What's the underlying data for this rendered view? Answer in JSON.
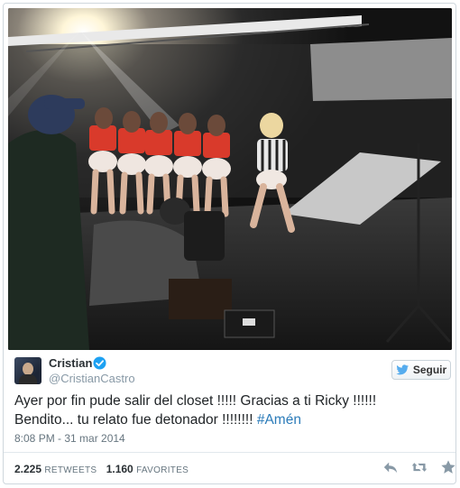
{
  "tweet": {
    "display_name": "Cristian",
    "handle": "@CristianCastro",
    "verified_icon": "verified-badge-icon",
    "follow_label": "Seguir",
    "text_part1": "Ayer por fin pude salir del closet !!!!! Gracias a ti Ricky !!!!!!",
    "text_part2": "Bendito... tu relato fue detonador !!!!!!!! ",
    "hashtag": "#Amén",
    "timestamp": "8:08 PM - 31 mar 2014",
    "retweets_count": "2.225",
    "retweets_label": "RETWEETS",
    "favorites_count": "1.160",
    "favorites_label": "FAVORITES",
    "actions": [
      "reply-icon",
      "retweet-icon",
      "favorite-icon"
    ]
  },
  "colors": {
    "link": "#2b7bb9",
    "verified": "#1da1f2",
    "muted": "#8899a6",
    "border": "#cfd7dd"
  }
}
